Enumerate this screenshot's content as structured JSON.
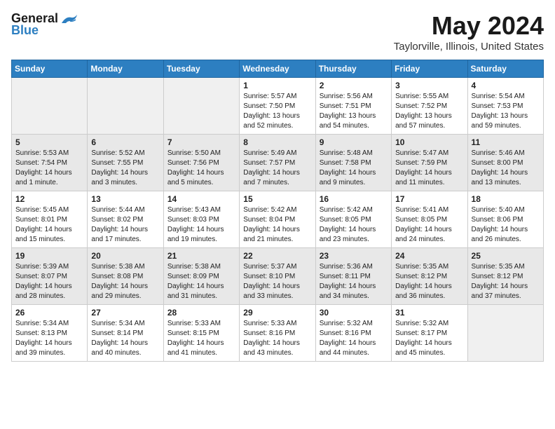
{
  "header": {
    "logo_general": "General",
    "logo_blue": "Blue",
    "month_title": "May 2024",
    "location": "Taylorville, Illinois, United States"
  },
  "weekdays": [
    "Sunday",
    "Monday",
    "Tuesday",
    "Wednesday",
    "Thursday",
    "Friday",
    "Saturday"
  ],
  "weeks": [
    [
      {
        "day": null
      },
      {
        "day": null
      },
      {
        "day": null
      },
      {
        "day": "1",
        "sunrise": "5:57 AM",
        "sunset": "7:50 PM",
        "daylight": "13 hours and 52 minutes."
      },
      {
        "day": "2",
        "sunrise": "5:56 AM",
        "sunset": "7:51 PM",
        "daylight": "13 hours and 54 minutes."
      },
      {
        "day": "3",
        "sunrise": "5:55 AM",
        "sunset": "7:52 PM",
        "daylight": "13 hours and 57 minutes."
      },
      {
        "day": "4",
        "sunrise": "5:54 AM",
        "sunset": "7:53 PM",
        "daylight": "13 hours and 59 minutes."
      }
    ],
    [
      {
        "day": "5",
        "sunrise": "5:53 AM",
        "sunset": "7:54 PM",
        "daylight": "14 hours and 1 minute."
      },
      {
        "day": "6",
        "sunrise": "5:52 AM",
        "sunset": "7:55 PM",
        "daylight": "14 hours and 3 minutes."
      },
      {
        "day": "7",
        "sunrise": "5:50 AM",
        "sunset": "7:56 PM",
        "daylight": "14 hours and 5 minutes."
      },
      {
        "day": "8",
        "sunrise": "5:49 AM",
        "sunset": "7:57 PM",
        "daylight": "14 hours and 7 minutes."
      },
      {
        "day": "9",
        "sunrise": "5:48 AM",
        "sunset": "7:58 PM",
        "daylight": "14 hours and 9 minutes."
      },
      {
        "day": "10",
        "sunrise": "5:47 AM",
        "sunset": "7:59 PM",
        "daylight": "14 hours and 11 minutes."
      },
      {
        "day": "11",
        "sunrise": "5:46 AM",
        "sunset": "8:00 PM",
        "daylight": "14 hours and 13 minutes."
      }
    ],
    [
      {
        "day": "12",
        "sunrise": "5:45 AM",
        "sunset": "8:01 PM",
        "daylight": "14 hours and 15 minutes."
      },
      {
        "day": "13",
        "sunrise": "5:44 AM",
        "sunset": "8:02 PM",
        "daylight": "14 hours and 17 minutes."
      },
      {
        "day": "14",
        "sunrise": "5:43 AM",
        "sunset": "8:03 PM",
        "daylight": "14 hours and 19 minutes."
      },
      {
        "day": "15",
        "sunrise": "5:42 AM",
        "sunset": "8:04 PM",
        "daylight": "14 hours and 21 minutes."
      },
      {
        "day": "16",
        "sunrise": "5:42 AM",
        "sunset": "8:05 PM",
        "daylight": "14 hours and 23 minutes."
      },
      {
        "day": "17",
        "sunrise": "5:41 AM",
        "sunset": "8:05 PM",
        "daylight": "14 hours and 24 minutes."
      },
      {
        "day": "18",
        "sunrise": "5:40 AM",
        "sunset": "8:06 PM",
        "daylight": "14 hours and 26 minutes."
      }
    ],
    [
      {
        "day": "19",
        "sunrise": "5:39 AM",
        "sunset": "8:07 PM",
        "daylight": "14 hours and 28 minutes."
      },
      {
        "day": "20",
        "sunrise": "5:38 AM",
        "sunset": "8:08 PM",
        "daylight": "14 hours and 29 minutes."
      },
      {
        "day": "21",
        "sunrise": "5:38 AM",
        "sunset": "8:09 PM",
        "daylight": "14 hours and 31 minutes."
      },
      {
        "day": "22",
        "sunrise": "5:37 AM",
        "sunset": "8:10 PM",
        "daylight": "14 hours and 33 minutes."
      },
      {
        "day": "23",
        "sunrise": "5:36 AM",
        "sunset": "8:11 PM",
        "daylight": "14 hours and 34 minutes."
      },
      {
        "day": "24",
        "sunrise": "5:35 AM",
        "sunset": "8:12 PM",
        "daylight": "14 hours and 36 minutes."
      },
      {
        "day": "25",
        "sunrise": "5:35 AM",
        "sunset": "8:12 PM",
        "daylight": "14 hours and 37 minutes."
      }
    ],
    [
      {
        "day": "26",
        "sunrise": "5:34 AM",
        "sunset": "8:13 PM",
        "daylight": "14 hours and 39 minutes."
      },
      {
        "day": "27",
        "sunrise": "5:34 AM",
        "sunset": "8:14 PM",
        "daylight": "14 hours and 40 minutes."
      },
      {
        "day": "28",
        "sunrise": "5:33 AM",
        "sunset": "8:15 PM",
        "daylight": "14 hours and 41 minutes."
      },
      {
        "day": "29",
        "sunrise": "5:33 AM",
        "sunset": "8:16 PM",
        "daylight": "14 hours and 43 minutes."
      },
      {
        "day": "30",
        "sunrise": "5:32 AM",
        "sunset": "8:16 PM",
        "daylight": "14 hours and 44 minutes."
      },
      {
        "day": "31",
        "sunrise": "5:32 AM",
        "sunset": "8:17 PM",
        "daylight": "14 hours and 45 minutes."
      },
      {
        "day": null
      }
    ]
  ]
}
